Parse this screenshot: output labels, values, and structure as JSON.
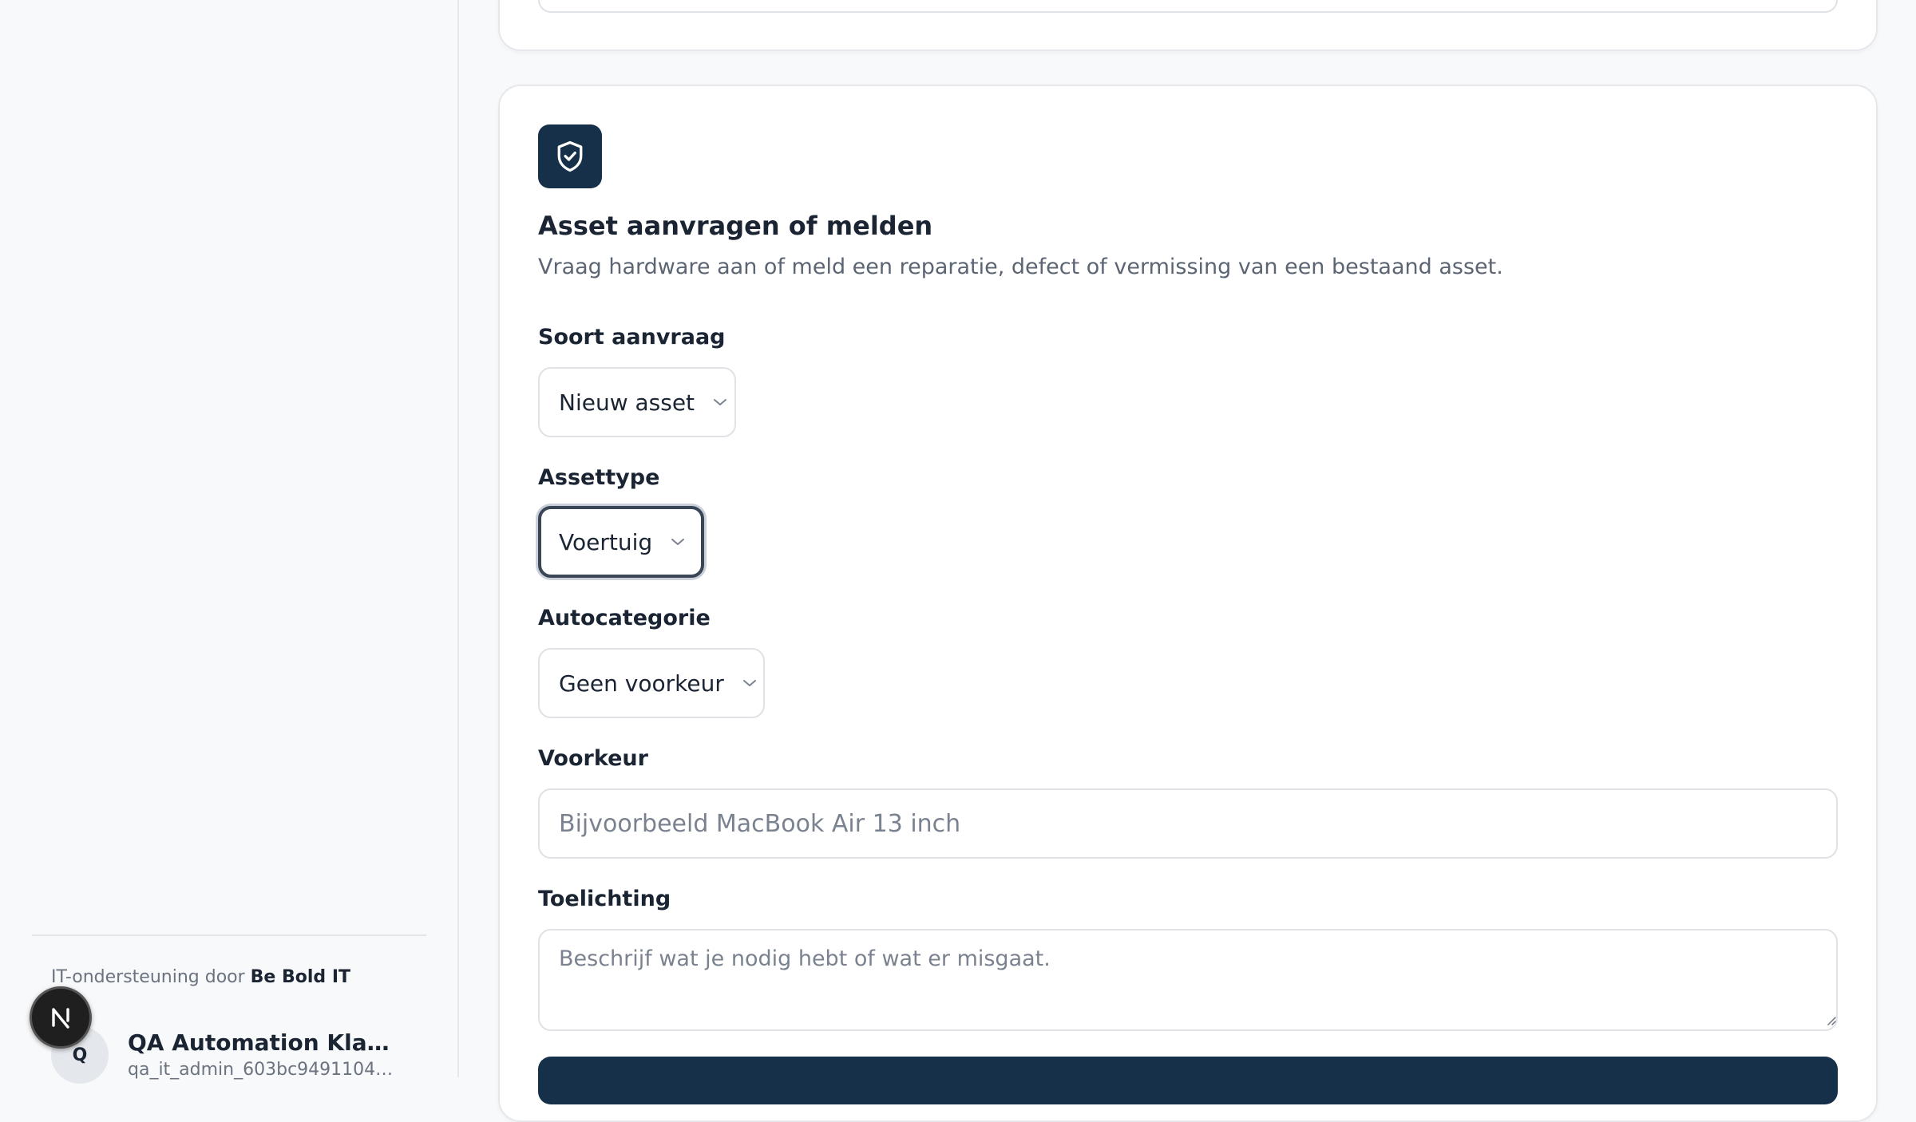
{
  "sidebar": {
    "support_prefix": "IT-ondersteuning door",
    "support_brand": "Be Bold IT",
    "user": {
      "initial": "Q",
      "name": "QA Automation Klantbeh...",
      "email": "qa_it_admin_603bc9491104bc..."
    },
    "floating_badge_letter": "N"
  },
  "form": {
    "icon": "shield-check-icon",
    "title": "Asset aanvragen of melden",
    "subtitle": "Vraag hardware aan of meld een reparatie, defect of vermissing van een bestaand asset.",
    "request_type": {
      "label": "Soort aanvraag",
      "value": "Nieuw asset"
    },
    "asset_type": {
      "label": "Assettype",
      "value": "Voertuig"
    },
    "car_category": {
      "label": "Autocategorie",
      "value": "Geen voorkeur"
    },
    "preference": {
      "label": "Voorkeur",
      "placeholder": "Bijvoorbeeld MacBook Air 13 inch"
    },
    "explanation": {
      "label": "Toelichting",
      "placeholder": "Beschrijf wat je nodig hebt of wat er misgaat."
    }
  },
  "colors": {
    "accent": "#17304a",
    "background": "#f8f9fa",
    "card": "#ffffff",
    "border": "#dfe2e6"
  }
}
